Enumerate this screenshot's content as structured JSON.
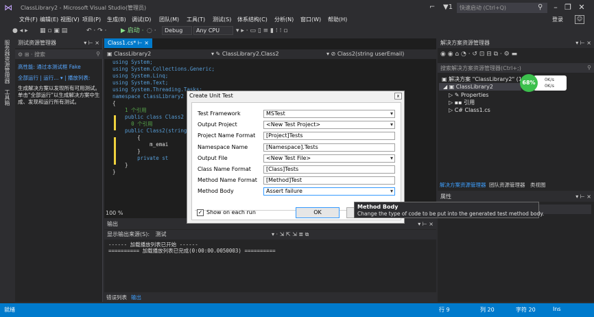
{
  "window": {
    "title": "ClassLibrary2 - Microsoft Visual Studio(管理员)",
    "quick_launch_placeholder": "快速启动 (Ctrl+Q)",
    "signin": "登录"
  },
  "menu": [
    "文件(F)",
    "编辑(E)",
    "视图(V)",
    "项目(P)",
    "生成(B)",
    "调试(D)",
    "团队(M)",
    "工具(T)",
    "测试(S)",
    "体系结构(C)",
    "分析(N)",
    "窗口(W)",
    "帮助(H)"
  ],
  "toolbar": {
    "start_label": "▶ 启动 ·",
    "config": "Debug",
    "platform": "Any CPU"
  },
  "left_strip": [
    "服务器资源管理器",
    "工具箱"
  ],
  "test_explorer": {
    "title": "测试资源管理器",
    "search_placeholder": "搜索",
    "info": "高性能: 通过本测试框 Fake",
    "links": "全部运行 | 运行... ▾ | 播放列表:",
    "message": "生成解决方案以发现所有可用测试。单击\"全部运行\"以生成解决方案中生成、发现和运行所有测试。"
  },
  "editor": {
    "tab_label": "Class1.cs*",
    "nav_project": "ClassLibrary2",
    "nav_class": "ClassLibrary2.Class2",
    "nav_member": "Class2(string userEmail)",
    "code_lines": [
      {
        "t": "using System;",
        "k": true
      },
      {
        "t": "using System.Collections.Generic;",
        "k": true
      },
      {
        "t": "using System.Linq;",
        "k": true
      },
      {
        "t": "using System.Text;",
        "k": true
      },
      {
        "t": "using System.Threading.Tasks;",
        "k": true
      },
      {
        "t": "",
        "k": false
      },
      {
        "t": "namespace ClassLibrary2",
        "k": true
      },
      {
        "t": "{",
        "k": false
      },
      {
        "t": "    1 个引用",
        "k": false
      },
      {
        "t": "    public class Class2",
        "k": true
      },
      {
        "t": "      0 个引用",
        "k": false
      },
      {
        "t": "    public Class2(string",
        "k": true
      },
      {
        "t": "        {",
        "k": false
      },
      {
        "t": "            m_emai",
        "k": false
      },
      {
        "t": "        }",
        "k": false
      },
      {
        "t": "        private st",
        "k": true
      },
      {
        "t": "",
        "k": false
      },
      {
        "t": "    }",
        "k": false
      },
      {
        "t": "}",
        "k": false
      }
    ],
    "zoom": "100 %"
  },
  "output": {
    "title": "输出",
    "source_label": "显示输出来源(S):",
    "source_value": "测试",
    "lines": [
      "------ 加载播放列表已开始 ------",
      "========== 加载播放列表已完成(0:00:00.0050003) =========="
    ],
    "tabs": [
      "错误列表",
      "输出"
    ]
  },
  "solution_explorer": {
    "title": "解决方案资源管理器",
    "search_placeholder": "搜索解决方案资源管理器(Ctrl+;)",
    "solution": "解决方案 \"ClassLibrary2\" (1",
    "project": "ClassLibrary2",
    "items": [
      "Properties",
      "引用",
      "Class1.cs"
    ],
    "tabs": [
      "解决方案资源管理器",
      "团队资源管理器",
      "类视图"
    ]
  },
  "perf": {
    "percent": "68%",
    "line1": "0K/s",
    "line2": "0K/s"
  },
  "properties": {
    "title": "属性"
  },
  "statusbar": {
    "ready": "就绪",
    "line": "行 9",
    "col": "列 20",
    "ch": "字符 20",
    "mode": "Ins"
  },
  "dialog": {
    "title": "Create Unit Test",
    "close": "x",
    "fields": [
      {
        "label": "Test Framework",
        "value": "MSTest",
        "type": "select"
      },
      {
        "label": "Output Project",
        "value": "<New Test Project>",
        "type": "select"
      },
      {
        "label": "Project Name Format",
        "value": "[Project]Tests",
        "type": "text"
      },
      {
        "label": "Namespace Name",
        "value": "[Namespace].Tests",
        "type": "text"
      },
      {
        "label": "Output File",
        "value": "<New Test File>",
        "type": "select"
      },
      {
        "label": "Class Name Format",
        "value": "[Class]Tests",
        "type": "text"
      },
      {
        "label": "Method Name Format",
        "value": "[Method]Test",
        "type": "text"
      },
      {
        "label": "Method Body",
        "value": "Assert failure",
        "type": "select"
      }
    ],
    "show_on_each_run": "Show on each run",
    "ok": "OK"
  },
  "tooltip": {
    "title": "Method Body",
    "text": "Change the type of code to be put into the generated test method body."
  }
}
